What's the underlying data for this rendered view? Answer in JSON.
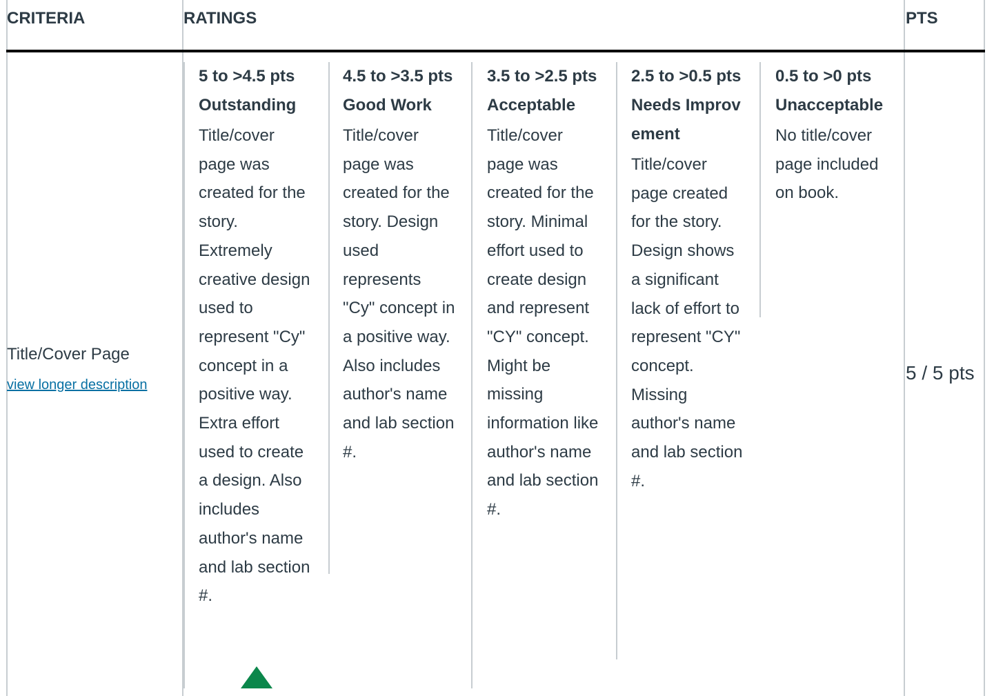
{
  "header": {
    "criteria": "CRITERIA",
    "ratings": "RATINGS",
    "pts": "PTS"
  },
  "criterion": {
    "title": "Title/Cover Page",
    "link": "view longer description"
  },
  "ratings": [
    {
      "pts": "5 to >4.5 pts",
      "label": "Outstanding",
      "description": "Title/cover page was created for the story. Extremely creative design used to represent \"Cy\" concept in a positive way. Extra effort used to create a design. Also includes author's name and lab section #.",
      "selected": true
    },
    {
      "pts": "4.5 to >3.5 pts",
      "label": "Good Work",
      "description": "Title/cover page was created for the story. Design used represents \"Cy\" concept in a positive way. Also includes author's name and lab section #.",
      "selected": false
    },
    {
      "pts": "3.5 to >2.5 pts",
      "label": "Acceptable",
      "description": "Title/cover page was created for the story. Minimal effort used to create design and represent \"CY\" concept. Might be missing information like author's name and lab section #.",
      "selected": false
    },
    {
      "pts": "2.5 to >0.5 pts",
      "label": "Needs Improvement",
      "description": "Title/cover page created for the story. Design shows a significant lack of effort to represent \"CY\" concept. Missing author's name and lab section #.",
      "selected": false
    },
    {
      "pts": "0.5 to >0 pts",
      "label": "Unacceptable",
      "description": "No title/cover page included on book.",
      "selected": false
    }
  ],
  "score": "5 / 5 pts",
  "colors": {
    "text": "#2d3b45",
    "link": "#0770a3",
    "selected_marker": "#0b874b",
    "border": "#c7cdd1"
  }
}
